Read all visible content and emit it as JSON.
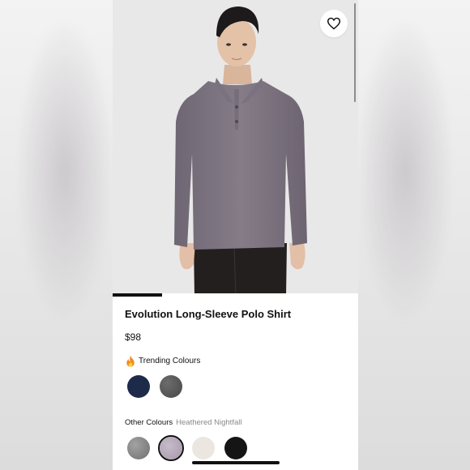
{
  "product": {
    "title": "Evolution Long-Sleeve Polo Shirt",
    "price": "$98",
    "favorite_icon": "heart-outline-icon",
    "image_progress": 0.2
  },
  "trending": {
    "icon": "flame-icon",
    "label": "Trending Colours",
    "swatches": [
      {
        "name": "navy",
        "color": "#1e2a4a"
      },
      {
        "name": "grey",
        "color": "#5a5a5a"
      }
    ]
  },
  "other": {
    "label": "Other Colours",
    "selected_value": "Heathered Nightfall",
    "swatches": [
      {
        "name": "heathered-grey",
        "color": "#8a8a8a"
      },
      {
        "name": "heathered-nightfall",
        "color": "#b5a9ba",
        "selected": true
      },
      {
        "name": "bone",
        "color": "#ebe7e0"
      },
      {
        "name": "black",
        "color": "#151515"
      }
    ]
  }
}
